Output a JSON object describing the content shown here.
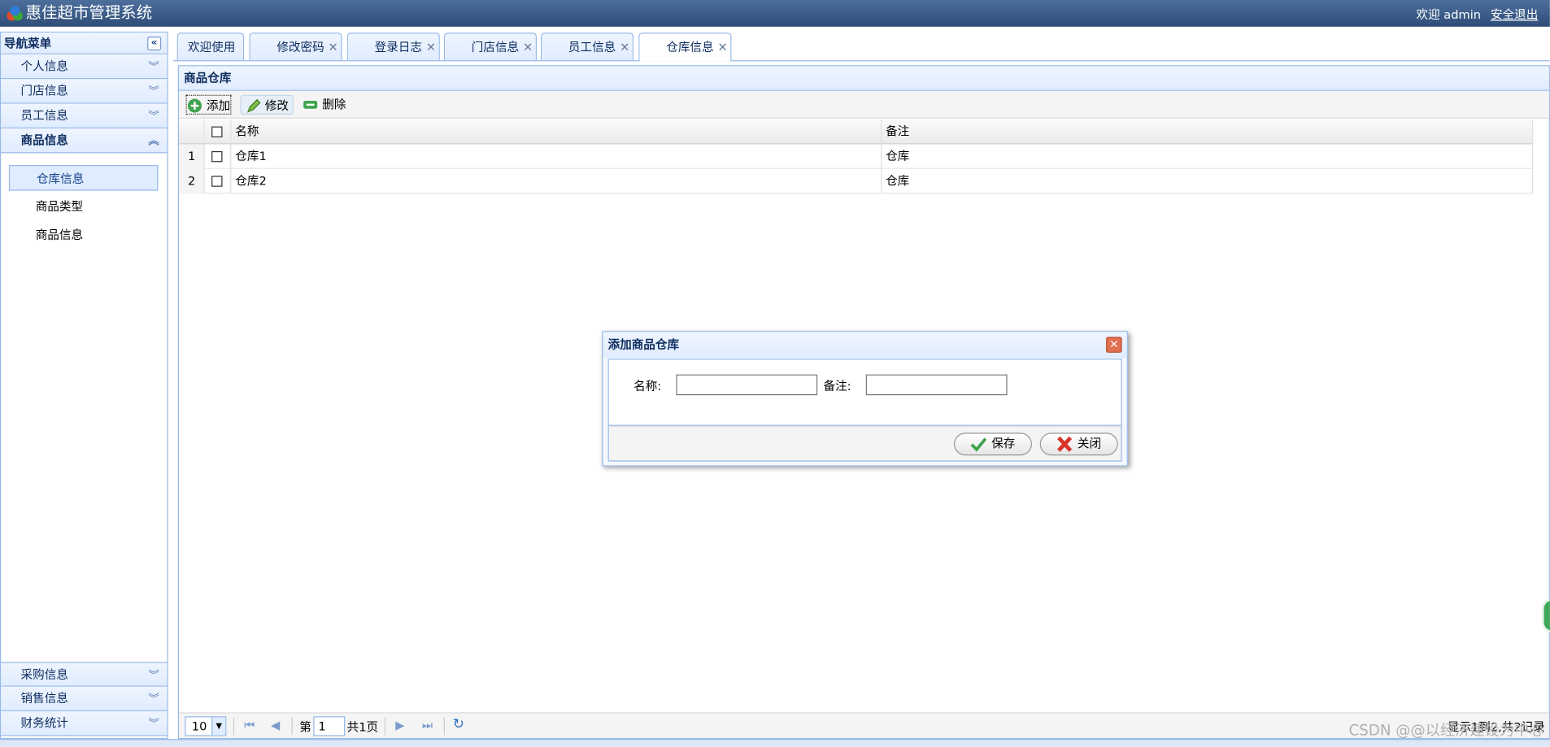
{
  "app": {
    "title": "惠佳超市管理系统",
    "welcome": "欢迎 admin",
    "logout": "安全退出"
  },
  "sidebar": {
    "header": "导航菜单",
    "sections": [
      {
        "label": "个人信息"
      },
      {
        "label": "门店信息"
      },
      {
        "label": "员工信息"
      },
      {
        "label": "商品信息"
      }
    ],
    "sub_items": [
      {
        "label": "仓库信息"
      },
      {
        "label": "商品类型"
      },
      {
        "label": "商品信息"
      }
    ],
    "bottom_sections": [
      {
        "label": "采购信息"
      },
      {
        "label": "销售信息"
      },
      {
        "label": "财务统计"
      }
    ]
  },
  "tabs": [
    {
      "label": "欢迎使用"
    },
    {
      "label": "修改密码"
    },
    {
      "label": "登录日志"
    },
    {
      "label": "门店信息"
    },
    {
      "label": "员工信息"
    },
    {
      "label": "仓库信息"
    }
  ],
  "panel": {
    "title": "商品仓库",
    "toolbar": {
      "add": "添加",
      "edit": "修改",
      "delete": "删除"
    },
    "columns": {
      "name": "名称",
      "remark": "备注"
    },
    "rows": [
      {
        "num": "1",
        "name": "仓库1",
        "remark": "仓库"
      },
      {
        "num": "2",
        "name": "仓库2",
        "remark": "仓库"
      }
    ]
  },
  "pager": {
    "page_size": "10",
    "page_prefix": "第",
    "page_value": "1",
    "page_suffix": "共1页",
    "info": "显示1到2,共2记录"
  },
  "dialog": {
    "title": "添加商品仓库",
    "name_label": "名称:",
    "remark_label": "备注:",
    "save": "保存",
    "close": "关闭"
  },
  "watermark": "CSDN @@以经济建设为中心",
  "colors": {
    "header_bg": "#3b5c88",
    "panel_border": "#95b8e7",
    "panel_header": "#e0ecff"
  }
}
